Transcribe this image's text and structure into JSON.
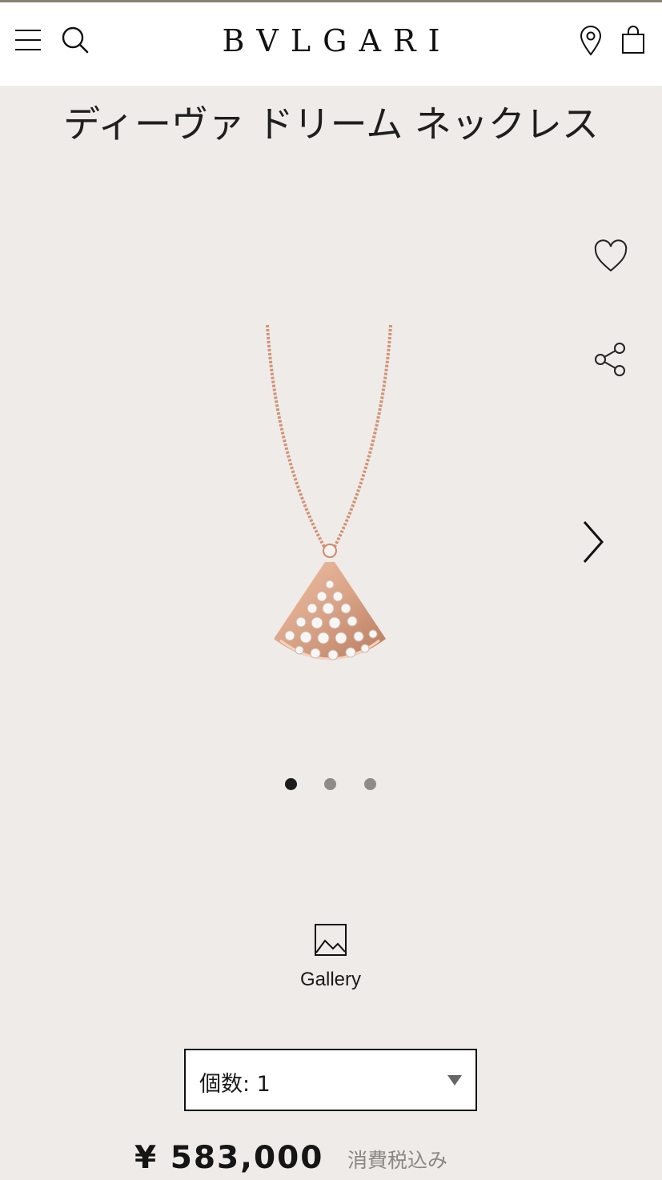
{
  "header": {
    "brand": "BVLGARI"
  },
  "product": {
    "title": "ディーヴァ ドリーム ネックレス",
    "image_alt": "necklace-image",
    "carousel": {
      "total": 3,
      "active_index": 0
    }
  },
  "gallery": {
    "label": "Gallery"
  },
  "quantity": {
    "label": "個数: 1"
  },
  "price": {
    "value": "¥ 583,000",
    "tax_note": "消費税込み"
  },
  "colors": {
    "background": "#efebe8",
    "header_bg": "#ffffff",
    "rose_gold": "#d9a285"
  },
  "icons": [
    "menu-icon",
    "search-icon",
    "location-pin-icon",
    "shopping-bag-icon",
    "heart-icon",
    "share-icon",
    "chevron-right-icon",
    "image-icon",
    "caret-down-icon"
  ]
}
